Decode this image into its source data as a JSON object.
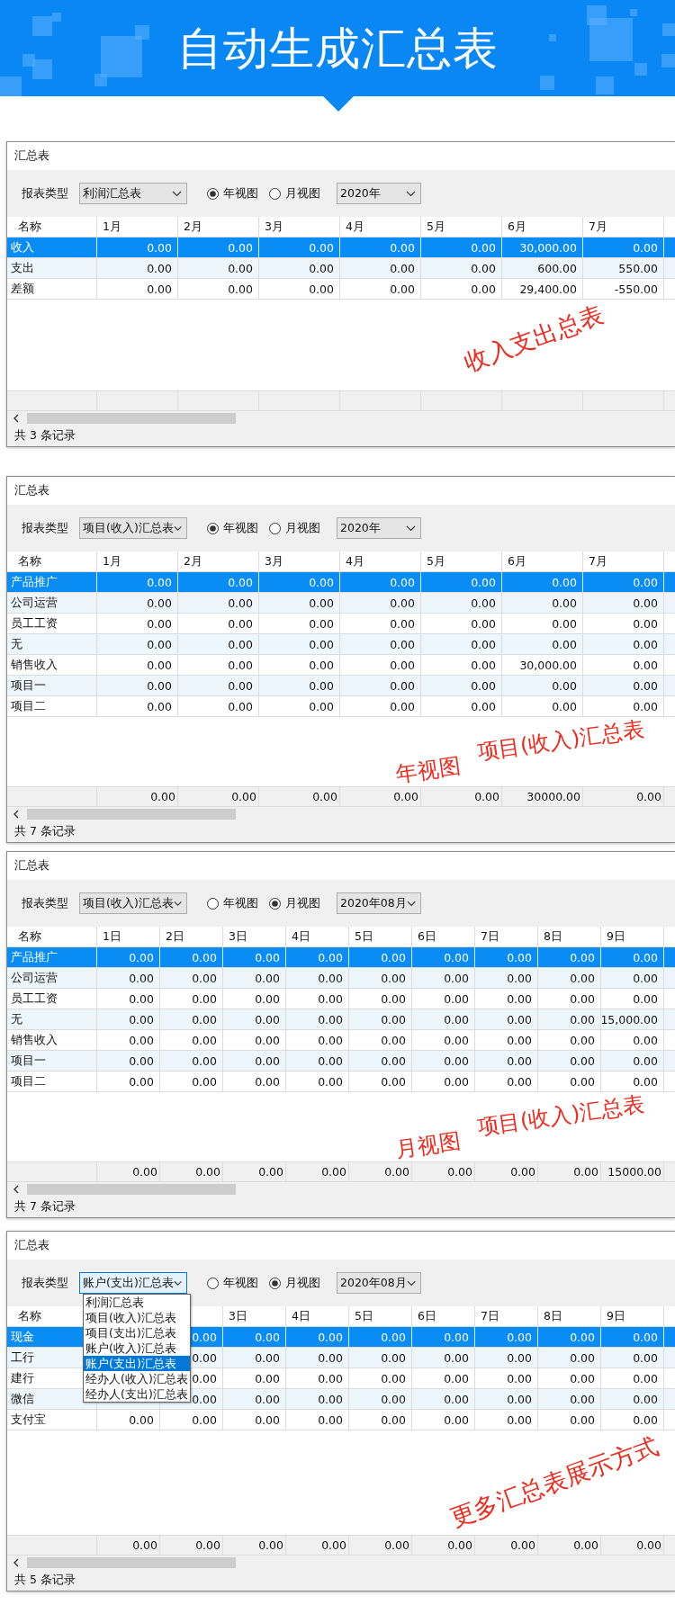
{
  "banner": {
    "title": "自动生成汇总表"
  },
  "panels": [
    {
      "title": "汇总表",
      "report_type_label": "报表类型",
      "report_type": {
        "value": "利润汇总表",
        "focused": false
      },
      "views": [
        {
          "label": "年视图",
          "selected": true
        },
        {
          "label": "月视图",
          "selected": false
        }
      ],
      "period": "2020年",
      "columns": [
        "名称",
        "1月",
        "2月",
        "3月",
        "4月",
        "5月",
        "6月",
        "7月"
      ],
      "rows": [
        {
          "name": "收入",
          "selected": true,
          "cells": [
            "0.00",
            "0.00",
            "0.00",
            "0.00",
            "0.00",
            "30,000.00",
            "0.00"
          ]
        },
        {
          "name": "支出",
          "selected": false,
          "cells": [
            "0.00",
            "0.00",
            "0.00",
            "0.00",
            "0.00",
            "600.00",
            "550.00"
          ]
        },
        {
          "name": "差额",
          "selected": false,
          "cells": [
            "0.00",
            "0.00",
            "0.00",
            "0.00",
            "0.00",
            "29,400.00",
            "-550.00"
          ]
        }
      ],
      "status": "共 3 条记录",
      "annotation": [
        "收入支出总表"
      ]
    },
    {
      "title": "汇总表",
      "report_type_label": "报表类型",
      "report_type": {
        "value": "项目(收入)汇总表",
        "focused": false
      },
      "views": [
        {
          "label": "年视图",
          "selected": true
        },
        {
          "label": "月视图",
          "selected": false
        }
      ],
      "period": "2020年",
      "columns": [
        "名称",
        "1月",
        "2月",
        "3月",
        "4月",
        "5月",
        "6月",
        "7月"
      ],
      "rows": [
        {
          "name": "产品推广",
          "selected": true,
          "cells": [
            "0.00",
            "0.00",
            "0.00",
            "0.00",
            "0.00",
            "0.00",
            "0.00"
          ]
        },
        {
          "name": "公司运营",
          "selected": false,
          "cells": [
            "0.00",
            "0.00",
            "0.00",
            "0.00",
            "0.00",
            "0.00",
            "0.00"
          ]
        },
        {
          "name": "员工工资",
          "selected": false,
          "cells": [
            "0.00",
            "0.00",
            "0.00",
            "0.00",
            "0.00",
            "0.00",
            "0.00"
          ]
        },
        {
          "name": "无",
          "selected": false,
          "cells": [
            "0.00",
            "0.00",
            "0.00",
            "0.00",
            "0.00",
            "0.00",
            "0.00"
          ]
        },
        {
          "name": "销售收入",
          "selected": false,
          "cells": [
            "0.00",
            "0.00",
            "0.00",
            "0.00",
            "0.00",
            "30,000.00",
            "0.00"
          ]
        },
        {
          "name": "项目一",
          "selected": false,
          "cells": [
            "0.00",
            "0.00",
            "0.00",
            "0.00",
            "0.00",
            "0.00",
            "0.00"
          ]
        },
        {
          "name": "项目二",
          "selected": false,
          "cells": [
            "0.00",
            "0.00",
            "0.00",
            "0.00",
            "0.00",
            "0.00",
            "0.00"
          ]
        }
      ],
      "totals": [
        "0.00",
        "0.00",
        "0.00",
        "0.00",
        "0.00",
        "30000.00",
        "0.00"
      ],
      "status": "共 7 条记录",
      "annotation": [
        "项目(收入)汇总表",
        "年视图"
      ]
    },
    {
      "title": "汇总表",
      "report_type_label": "报表类型",
      "report_type": {
        "value": "项目(收入)汇总表",
        "focused": false
      },
      "views": [
        {
          "label": "年视图",
          "selected": false
        },
        {
          "label": "月视图",
          "selected": true
        }
      ],
      "period": "2020年08月",
      "columns": [
        "名称",
        "1日",
        "2日",
        "3日",
        "4日",
        "5日",
        "6日",
        "7日",
        "8日",
        "9日"
      ],
      "rows": [
        {
          "name": "产品推广",
          "selected": true,
          "cells": [
            "0.00",
            "0.00",
            "0.00",
            "0.00",
            "0.00",
            "0.00",
            "0.00",
            "0.00",
            "0.00"
          ]
        },
        {
          "name": "公司运营",
          "selected": false,
          "cells": [
            "0.00",
            "0.00",
            "0.00",
            "0.00",
            "0.00",
            "0.00",
            "0.00",
            "0.00",
            "0.00"
          ]
        },
        {
          "name": "员工工资",
          "selected": false,
          "cells": [
            "0.00",
            "0.00",
            "0.00",
            "0.00",
            "0.00",
            "0.00",
            "0.00",
            "0.00",
            "0.00"
          ]
        },
        {
          "name": "无",
          "selected": false,
          "cells": [
            "0.00",
            "0.00",
            "0.00",
            "0.00",
            "0.00",
            "0.00",
            "0.00",
            "0.00",
            "15,000.00"
          ]
        },
        {
          "name": "销售收入",
          "selected": false,
          "cells": [
            "0.00",
            "0.00",
            "0.00",
            "0.00",
            "0.00",
            "0.00",
            "0.00",
            "0.00",
            "0.00"
          ]
        },
        {
          "name": "项目一",
          "selected": false,
          "cells": [
            "0.00",
            "0.00",
            "0.00",
            "0.00",
            "0.00",
            "0.00",
            "0.00",
            "0.00",
            "0.00"
          ]
        },
        {
          "name": "项目二",
          "selected": false,
          "cells": [
            "0.00",
            "0.00",
            "0.00",
            "0.00",
            "0.00",
            "0.00",
            "0.00",
            "0.00",
            "0.00"
          ]
        }
      ],
      "totals": [
        "0.00",
        "0.00",
        "0.00",
        "0.00",
        "0.00",
        "0.00",
        "0.00",
        "0.00",
        "15000.00"
      ],
      "status": "共 7 条记录",
      "annotation": [
        "项目(收入)汇总表",
        "月视图"
      ]
    },
    {
      "title": "汇总表",
      "report_type_label": "报表类型",
      "report_type": {
        "value": "账户(支出)汇总表",
        "focused": true,
        "options": [
          {
            "label": "利润汇总表",
            "selected": false
          },
          {
            "label": "项目(收入)汇总表",
            "selected": false
          },
          {
            "label": "项目(支出)汇总表",
            "selected": false
          },
          {
            "label": "账户(收入)汇总表",
            "selected": false
          },
          {
            "label": "账户(支出)汇总表",
            "selected": true
          },
          {
            "label": "经办人(收入)汇总表",
            "selected": false
          },
          {
            "label": "经办人(支出)汇总表",
            "selected": false
          }
        ]
      },
      "views": [
        {
          "label": "年视图",
          "selected": false
        },
        {
          "label": "月视图",
          "selected": true
        }
      ],
      "period": "2020年08月",
      "columns": [
        "名称",
        null,
        null,
        "3日",
        "4日",
        "5日",
        "6日",
        "7日",
        "8日",
        "9日"
      ],
      "rows": [
        {
          "name": "现金",
          "selected": true,
          "cells": [
            null,
            "0.00",
            "0.00",
            "0.00",
            "0.00",
            "0.00",
            "0.00",
            "0.00",
            "0.00"
          ]
        },
        {
          "name": "工行",
          "selected": false,
          "cells": [
            null,
            "0.00",
            "0.00",
            "0.00",
            "0.00",
            "0.00",
            "0.00",
            "0.00",
            "0.00"
          ]
        },
        {
          "name": "建行",
          "selected": false,
          "cells": [
            null,
            "0.00",
            "0.00",
            "0.00",
            "0.00",
            "0.00",
            "0.00",
            "0.00",
            "0.00"
          ]
        },
        {
          "name": "微信",
          "selected": false,
          "cells": [
            null,
            "0.00",
            "0.00",
            "0.00",
            "0.00",
            "0.00",
            "0.00",
            "0.00",
            "0.00"
          ]
        },
        {
          "name": "支付宝",
          "selected": false,
          "cells": [
            "0.00",
            "0.00",
            "0.00",
            "0.00",
            "0.00",
            "0.00",
            "0.00",
            "0.00",
            "0.00"
          ]
        }
      ],
      "totals": [
        "0.00",
        "0.00",
        "0.00",
        "0.00",
        "0.00",
        "0.00",
        "0.00",
        "0.00",
        "0.00"
      ],
      "status": "共 5 条记录",
      "annotation": [
        "更多汇总表展示方式"
      ]
    }
  ]
}
